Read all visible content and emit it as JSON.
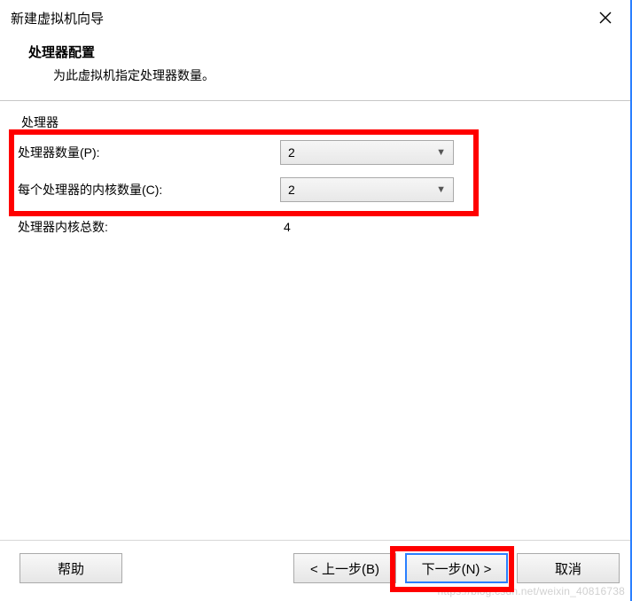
{
  "window": {
    "title": "新建虚拟机向导"
  },
  "header": {
    "title": "处理器配置",
    "subtitle": "为此虚拟机指定处理器数量。"
  },
  "fieldset": {
    "legend": "处理器"
  },
  "form": {
    "processor_count_label": "处理器数量(P):",
    "processor_count_value": "2",
    "cores_per_processor_label": "每个处理器的内核数量(C):",
    "cores_per_processor_value": "2",
    "total_cores_label": "处理器内核总数:",
    "total_cores_value": "4"
  },
  "buttons": {
    "help": "帮助",
    "back": "< 上一步(B)",
    "next": "下一步(N) >",
    "cancel": "取消"
  },
  "watermark": "https://blog.csdn.net/weixin_40816738"
}
